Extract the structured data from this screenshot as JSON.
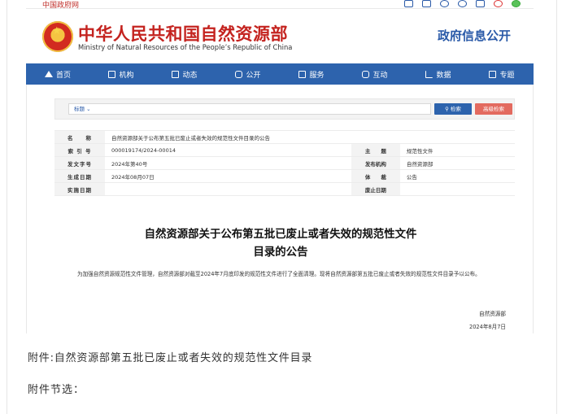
{
  "topbar": {
    "gov_link": "中国政府网",
    "icons": [
      "mail-icon",
      "mail-send-icon",
      "accessibility-icon",
      "settings-icon",
      "mobile-icon",
      "weibo-icon",
      "wechat-icon"
    ]
  },
  "header": {
    "title": "中华人民共和国自然资源部",
    "subtitle": "Ministry of Natural Resources of the People’s Republic of China",
    "open_title": "政府信息公开",
    "brand_color": "#c4231f",
    "accent_color": "#2d63ad"
  },
  "nav": {
    "items": [
      {
        "label": "首页",
        "icon": "home-icon"
      },
      {
        "label": "机构",
        "icon": "org-icon"
      },
      {
        "label": "动态",
        "icon": "book-icon"
      },
      {
        "label": "公开",
        "icon": "screen-icon"
      },
      {
        "label": "服务",
        "icon": "edit-icon"
      },
      {
        "label": "互动",
        "icon": "chat-icon"
      },
      {
        "label": "数据",
        "icon": "bar-chart-icon"
      },
      {
        "label": "专题",
        "icon": "topic-icon"
      }
    ]
  },
  "search": {
    "field_selector": "标题",
    "search_label": "检索",
    "advanced_label": "高级检索"
  },
  "info": {
    "name_label": "名　　称",
    "name_value": "自然资源部关于公布第五批已废止或者失效的规范性文件目录的公告",
    "index_label": "索 引 号",
    "index_value": "000019174/2024-00014",
    "subject_label": "主　　题",
    "subject_value": "规范性文件",
    "docno_label": "发文字号",
    "docno_value": "2024年第40号",
    "issuer_label": "发布机构",
    "issuer_value": "自然资源部",
    "created_label": "生成日期",
    "created_value": "2024年08月07日",
    "genre_label": "体　　裁",
    "genre_value": "公告",
    "effective_label": "实施日期",
    "effective_value": "",
    "expiry_label": "废止日期",
    "expiry_value": ""
  },
  "article": {
    "title_line1": "自然资源部关于公布第五批已废止或者失效的规范性文件",
    "title_line2": "目录的公告",
    "body": "为加强自然资源规范性文件管理，自然资源部对截至2024年7月底印发的规范性文件进行了全面清理。现将自然资源部第五批已废止或者失效的规范性文件目录予以公布。",
    "signature": "自然资源部",
    "date": "2024年8月7日"
  },
  "below": {
    "attachment": "附件:自然资源部第五批已废止或者失效的规范性文件目录",
    "section": "附件节选："
  }
}
